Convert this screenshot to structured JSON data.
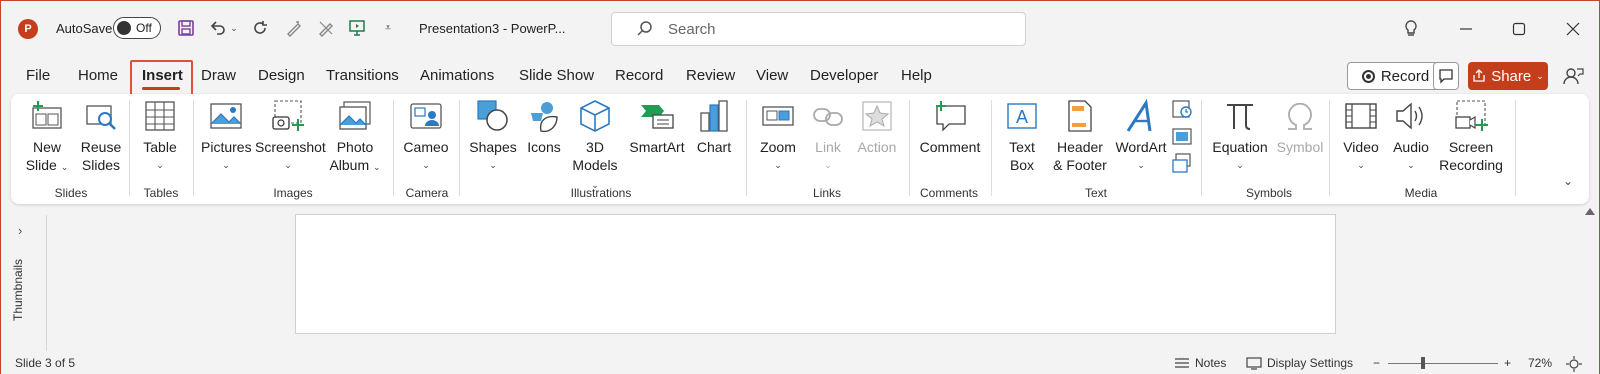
{
  "titlebar": {
    "logo_letter": "P",
    "autosave_label": "AutoSave",
    "autosave_state": "Off",
    "doc_title": "Presentation3  -  PowerP...",
    "search_placeholder": "Search"
  },
  "tabs": [
    {
      "label": "File"
    },
    {
      "label": "Home"
    },
    {
      "label": "Insert",
      "active": true
    },
    {
      "label": "Draw"
    },
    {
      "label": "Design"
    },
    {
      "label": "Transitions"
    },
    {
      "label": "Animations"
    },
    {
      "label": "Slide Show"
    },
    {
      "label": "Record"
    },
    {
      "label": "Review"
    },
    {
      "label": "View"
    },
    {
      "label": "Developer"
    },
    {
      "label": "Help"
    }
  ],
  "right_actions": {
    "record_label": "Record",
    "share_label": "Share"
  },
  "ribbon": {
    "groups": {
      "slides": "Slides",
      "tables": "Tables",
      "images": "Images",
      "camera": "Camera",
      "illustrations": "Illustrations",
      "links": "Links",
      "comments": "Comments",
      "text": "Text",
      "symbols": "Symbols",
      "media": "Media"
    },
    "buttons": {
      "new_slide_1": "New",
      "new_slide_2": "Slide",
      "reuse_1": "Reuse",
      "reuse_2": "Slides",
      "table": "Table",
      "pictures": "Pictures",
      "screenshot": "Screenshot",
      "photo_1": "Photo",
      "photo_2": "Album",
      "cameo": "Cameo",
      "shapes": "Shapes",
      "icons": "Icons",
      "models_1": "3D",
      "models_2": "Models",
      "smartart": "SmartArt",
      "chart": "Chart",
      "zoom": "Zoom",
      "link": "Link",
      "action": "Action",
      "comment": "Comment",
      "textbox_1": "Text",
      "textbox_2": "Box",
      "header_1": "Header",
      "header_2": "& Footer",
      "wordart": "WordArt",
      "equation": "Equation",
      "symbol": "Symbol",
      "video": "Video",
      "audio": "Audio",
      "screenrec_1": "Screen",
      "screenrec_2": "Recording"
    }
  },
  "thumbnails_label": "Thumbnails",
  "status": {
    "slide_info": "Slide 3 of 5",
    "notes": "Notes",
    "display_settings": "Display Settings",
    "zoom_minus": "−",
    "zoom_plus": "+",
    "zoom_level": "72%",
    "zoom_fraction": 0.32
  },
  "colors": {
    "accent": "#c43e1c",
    "highlight": "#e0503a",
    "icon_blue": "#2b79c2",
    "icon_green": "#1f9d55"
  }
}
